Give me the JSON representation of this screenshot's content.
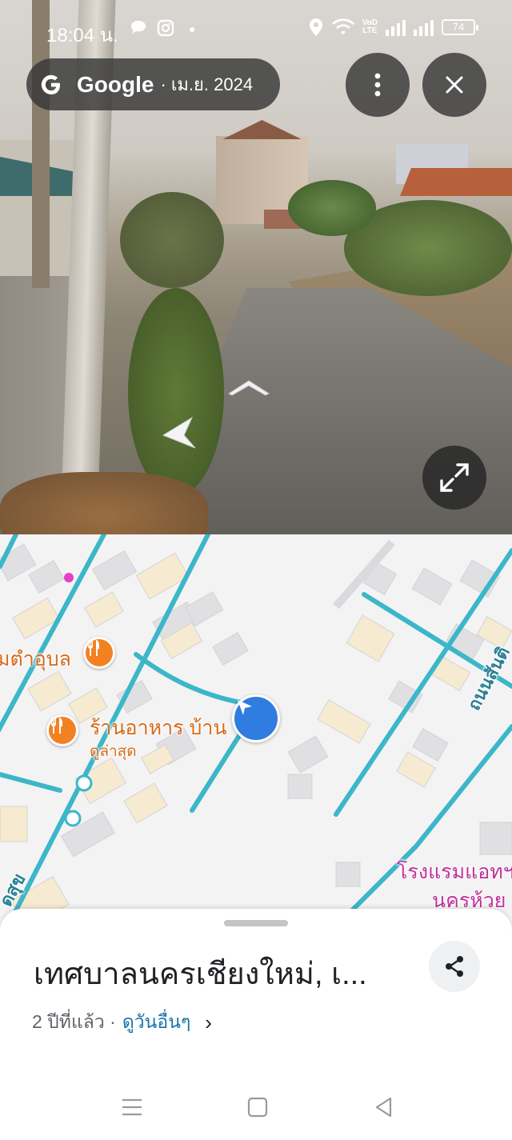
{
  "status_bar": {
    "time": "18:04 น.",
    "lte_label": "VoD\nLTE",
    "battery": "74"
  },
  "street_view": {
    "brand": "Google",
    "date": "· เม.ย. 2024"
  },
  "map": {
    "places": [
      {
        "name": "มตำอุบล",
        "type": "restaurant"
      },
      {
        "name": "ร้านอาหาร บ้าน",
        "sub": "ดูล่าสุด",
        "type": "restaurant"
      },
      {
        "name": "โรงแรมแอทฯ",
        "sub": "นครห้วย",
        "type": "hotel"
      }
    ],
    "streets": [
      "ถนนสันติ",
      "ดสุข"
    ],
    "colors": {
      "road": "#3cb6c9",
      "restaurant_pin": "#f28122",
      "hotel_label": "#c2329c",
      "location": "#2f7de1"
    }
  },
  "sheet": {
    "title": "เทศบาลนครเชียงใหม่, เ...",
    "age": "2 ปีที่แล้ว ·",
    "see_more": "ดูวันอื่นๆ",
    "chevron": "›"
  },
  "icons": [
    "google-g-icon",
    "more-vert-icon",
    "close-icon",
    "expand-icon",
    "share-icon",
    "location-arrow-icon",
    "fork-knife-icon"
  ]
}
